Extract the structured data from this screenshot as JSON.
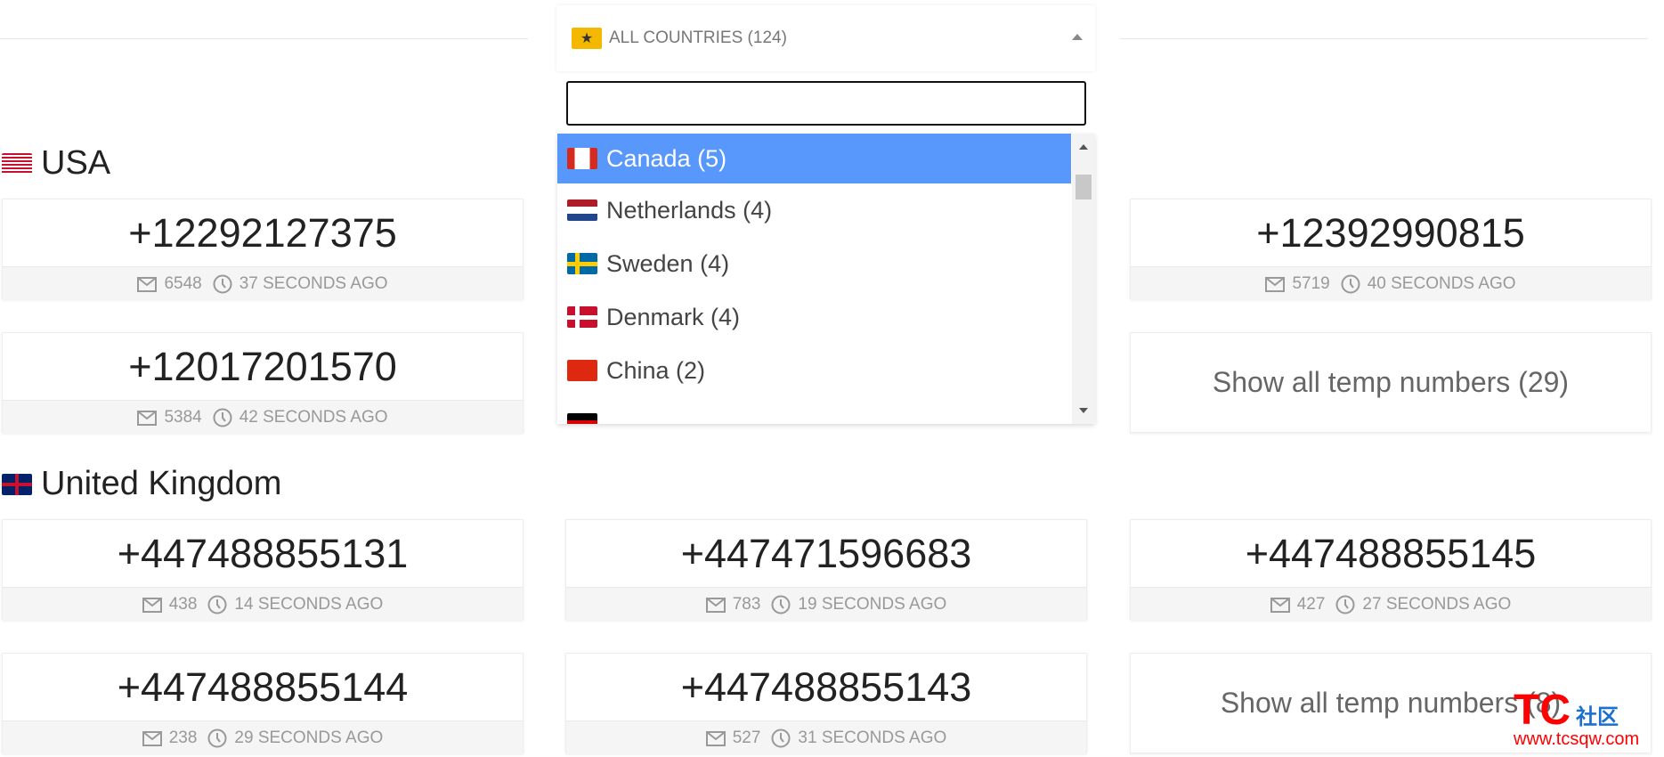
{
  "dropdown": {
    "selected_label": "ALL COUNTRIES (124)",
    "search_value": "",
    "options": [
      {
        "label": "Canada (5)",
        "flag": "canada",
        "highlighted": true
      },
      {
        "label": "Netherlands (4)",
        "flag": "netherlands"
      },
      {
        "label": "Sweden (4)",
        "flag": "sweden"
      },
      {
        "label": "Denmark (4)",
        "flag": "denmark"
      },
      {
        "label": "China (2)",
        "flag": "china"
      },
      {
        "label": "",
        "flag": "germany"
      }
    ]
  },
  "sections": [
    {
      "title": "USA",
      "flag": "usa",
      "cards": [
        {
          "col": 0,
          "row": 0,
          "number": "+12292127375",
          "messages": "6548",
          "time": "37 SECONDS AGO"
        },
        {
          "col": 2,
          "row": 0,
          "number": "+12392990815",
          "messages": "5719",
          "time": "40 SECONDS AGO"
        },
        {
          "col": 0,
          "row": 1,
          "number": "+12017201570",
          "messages": "5384",
          "time": "42 SECONDS AGO"
        }
      ],
      "show_all": {
        "col": 2,
        "row": 1,
        "label": "Show all temp numbers (29)"
      }
    },
    {
      "title": "United Kingdom",
      "flag": "uk",
      "cards": [
        {
          "col": 0,
          "row": 0,
          "number": "+447488855131",
          "messages": "438",
          "time": "14 SECONDS AGO"
        },
        {
          "col": 1,
          "row": 0,
          "number": "+447471596683",
          "messages": "783",
          "time": "19 SECONDS AGO"
        },
        {
          "col": 2,
          "row": 0,
          "number": "+447488855145",
          "messages": "427",
          "time": "27 SECONDS AGO"
        },
        {
          "col": 0,
          "row": 1,
          "number": "+447488855144",
          "messages": "238",
          "time": "29 SECONDS AGO"
        },
        {
          "col": 1,
          "row": 1,
          "number": "+447488855143",
          "messages": "527",
          "time": "31 SECONDS AGO"
        }
      ],
      "show_all": {
        "col": 2,
        "row": 1,
        "label": "Show all temp numbers (8)"
      }
    }
  ],
  "watermark": {
    "brand": "TC",
    "suffix": "社区",
    "url": "www.tcsqw.com"
  },
  "colors": {
    "highlight": "#5897fb",
    "star_badge": "#f5b800"
  }
}
